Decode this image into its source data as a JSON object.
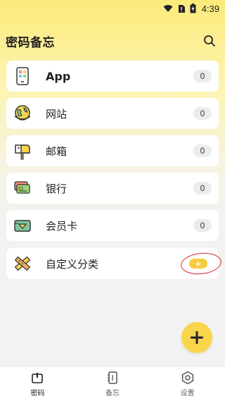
{
  "status_bar": {
    "time": "4:39",
    "icons": [
      "wifi-icon",
      "no-sim-icon",
      "battery-charging-icon"
    ]
  },
  "header": {
    "title": "密码备忘",
    "search_icon": "search-icon"
  },
  "categories": [
    {
      "label": "App",
      "count": "0",
      "icon": "phone-app-icon"
    },
    {
      "label": "网站",
      "count": "0",
      "icon": "globe-icon"
    },
    {
      "label": "邮箱",
      "count": "0",
      "icon": "mailbox-icon"
    },
    {
      "label": "银行",
      "count": "0",
      "icon": "bank-cards-icon"
    },
    {
      "label": "会员卡",
      "count": "0",
      "icon": "member-card-icon"
    }
  ],
  "custom_category": {
    "label": "自定义分类",
    "add_label": "+",
    "icon": "ruler-pencil-icon"
  },
  "fab": {
    "label": "+"
  },
  "bottom_nav": [
    {
      "label": "密码",
      "icon": "password-icon",
      "active": true
    },
    {
      "label": "备忘",
      "icon": "notebook-icon",
      "active": false
    },
    {
      "label": "设置",
      "icon": "settings-icon",
      "active": false
    }
  ],
  "colors": {
    "accent_yellow": "#f9d54b",
    "highlight_red": "#d92424",
    "card_bg": "#ffffff",
    "badge_bg": "#ececec"
  }
}
